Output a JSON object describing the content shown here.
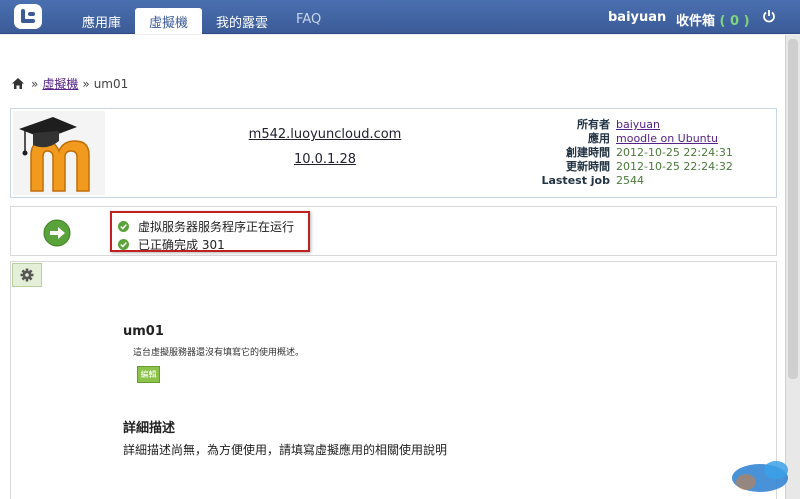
{
  "nav": {
    "tabs": [
      {
        "label": "應用庫"
      },
      {
        "label": "虛擬機"
      },
      {
        "label": "我的露雲"
      },
      {
        "label": "FAQ"
      }
    ],
    "user": "baiyuan",
    "inbox_label": "收件箱",
    "inbox_count": "( 0 )"
  },
  "breadcrumb": {
    "sep": "»",
    "link": "虛擬機",
    "current": "um01"
  },
  "vm": {
    "host": "m542.luoyuncloud.com",
    "ip": "10.0.1.28",
    "meta": [
      {
        "key": "所有者",
        "value": "baiyuan"
      },
      {
        "key": "應用",
        "value": "moodle on Ubuntu"
      },
      {
        "key": "創建時間",
        "value": "2012-10-25 22:24:31"
      },
      {
        "key": "更新時間",
        "value": "2012-10-25 22:24:32"
      },
      {
        "key": "Lastest job",
        "value": "2544"
      }
    ]
  },
  "status": {
    "line1": "虚拟服务器服务程序正在运行",
    "line2": "已正确完成 301"
  },
  "detail": {
    "name": "um01",
    "desc": "這台虛擬服務器還沒有填寫它的使用概述。",
    "edit_label": "編輯",
    "title": "詳細描述",
    "text": "詳細描述尚無，為方便使用，請填寫虛擬應用的相關使用說明"
  },
  "colors": {
    "nav_bg": "#3b5b98",
    "status_border": "#c02020",
    "ok_green": "#5aa33a",
    "edit_green": "#8bc34a"
  },
  "icons": [
    "app-logo-icon",
    "home-icon",
    "power-icon",
    "moodle-logo-icon",
    "go-arrow-icon",
    "check-icon",
    "gear-icon"
  ]
}
